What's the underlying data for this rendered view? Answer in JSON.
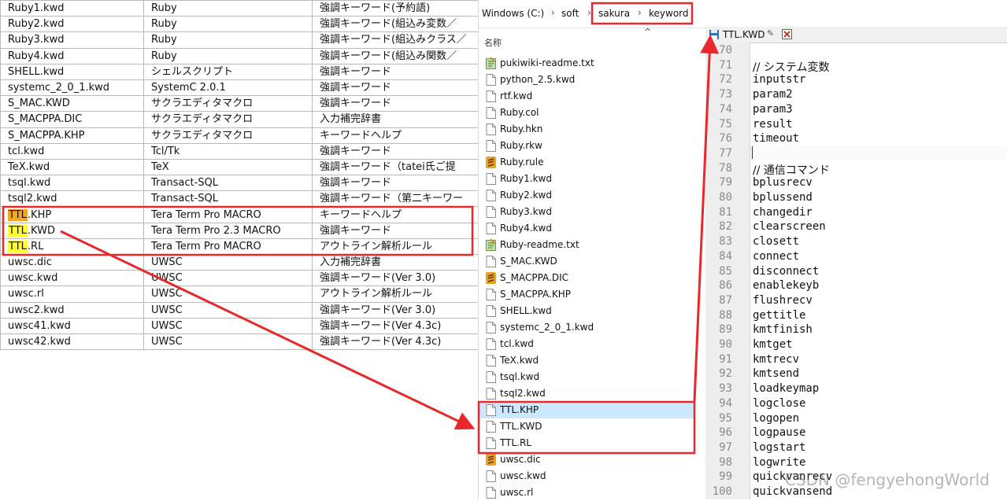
{
  "table": {
    "rows": [
      {
        "file": "Ruby1.kwd",
        "lang": "Ruby",
        "desc": "強調キーワード(予約語)"
      },
      {
        "file": "Ruby2.kwd",
        "lang": "Ruby",
        "desc": "強調キーワード(組込み変数／"
      },
      {
        "file": "Ruby3.kwd",
        "lang": "Ruby",
        "desc": "強調キーワード(組込みクラス／"
      },
      {
        "file": "Ruby4.kwd",
        "lang": "Ruby",
        "desc": "強調キーワード(組込み関数／"
      },
      {
        "file": "SHELL.kwd",
        "lang": "シェルスクリプト",
        "desc": "強調キーワード"
      },
      {
        "file": "systemc_2_0_1.kwd",
        "lang": "SystemC 2.0.1",
        "desc": "強調キーワード"
      },
      {
        "file": "S_MAC.KWD",
        "lang": "サクラエディタマクロ",
        "desc": "強調キーワード"
      },
      {
        "file": "S_MACPPA.DIC",
        "lang": "サクラエディタマクロ",
        "desc": "入力補完辞書"
      },
      {
        "file": "S_MACPPA.KHP",
        "lang": "サクラエディタマクロ",
        "desc": "キーワードヘルプ"
      },
      {
        "file": "tcl.kwd",
        "lang": "Tcl/Tk",
        "desc": "強調キーワード"
      },
      {
        "file": "TeX.kwd",
        "lang": "TeX",
        "desc": "強調キーワード（tatei氏ご提"
      },
      {
        "file": "tsql.kwd",
        "lang": "Transact-SQL",
        "desc": "強調キーワード"
      },
      {
        "file": "tsql2.kwd",
        "lang": "Transact-SQL",
        "desc": "強調キーワード（第二キーワー"
      },
      {
        "file_hl": "TTL",
        "file_rest": ".KHP",
        "hl_color": "#f5a623",
        "lang": "Tera Term Pro MACRO",
        "desc": "キーワードヘルプ"
      },
      {
        "file_hl": "TTL",
        "file_rest": ".KWD",
        "hl_color": "#ffff33",
        "lang": "Tera Term Pro 2.3 MACRO",
        "desc": "強調キーワード"
      },
      {
        "file_hl": "TTL",
        "file_rest": ".RL",
        "hl_color": "#ffff33",
        "lang": "Tera Term Pro MACRO",
        "desc": "アウトライン解析ルール"
      },
      {
        "file": "uwsc.dic",
        "lang": "UWSC",
        "desc": "入力補完辞書"
      },
      {
        "file": "uwsc.kwd",
        "lang": "UWSC",
        "desc": "強調キーワード(Ver 3.0)"
      },
      {
        "file": "uwsc.rl",
        "lang": "UWSC",
        "desc": "アウトライン解析ルール"
      },
      {
        "file": "uwsc2.kwd",
        "lang": "UWSC",
        "desc": "強調キーワード(Ver 3.0)"
      },
      {
        "file": "uwsc41.kwd",
        "lang": "UWSC",
        "desc": "強調キーワード(Ver 4.3c)"
      },
      {
        "file": "uwsc42.kwd",
        "lang": "UWSC",
        "desc": "強調キーワード(Ver 4.3c)"
      }
    ]
  },
  "explorer": {
    "breadcrumb": [
      "Windows (C:)",
      "soft",
      "sakura",
      "keyword"
    ],
    "breadcrumb_sep": "›",
    "sort_arrow": "^",
    "column_name": "名称",
    "files": [
      {
        "name": "pukiwiki-readme.txt",
        "icon": "notepad-icon"
      },
      {
        "name": "python_2.5.kwd",
        "icon": "file-icon"
      },
      {
        "name": "rtf.kwd",
        "icon": "file-icon"
      },
      {
        "name": "Ruby.col",
        "icon": "file-icon"
      },
      {
        "name": "Ruby.hkn",
        "icon": "file-icon"
      },
      {
        "name": "Ruby.rkw",
        "icon": "file-icon"
      },
      {
        "name": "Ruby.rule",
        "icon": "sublime-icon"
      },
      {
        "name": "Ruby1.kwd",
        "icon": "file-icon"
      },
      {
        "name": "Ruby2.kwd",
        "icon": "file-icon"
      },
      {
        "name": "Ruby3.kwd",
        "icon": "file-icon"
      },
      {
        "name": "Ruby4.kwd",
        "icon": "file-icon"
      },
      {
        "name": "Ruby-readme.txt",
        "icon": "notepad-icon"
      },
      {
        "name": "S_MAC.KWD",
        "icon": "file-icon"
      },
      {
        "name": "S_MACPPA.DIC",
        "icon": "sublime-icon"
      },
      {
        "name": "S_MACPPA.KHP",
        "icon": "file-icon"
      },
      {
        "name": "SHELL.kwd",
        "icon": "file-icon"
      },
      {
        "name": "systemc_2_0_1.kwd",
        "icon": "file-icon"
      },
      {
        "name": "tcl.kwd",
        "icon": "file-icon"
      },
      {
        "name": "TeX.kwd",
        "icon": "file-icon"
      },
      {
        "name": "tsql.kwd",
        "icon": "file-icon"
      },
      {
        "name": "tsql2.kwd",
        "icon": "file-icon"
      },
      {
        "name": "TTL.KHP",
        "icon": "file-icon",
        "selected": true
      },
      {
        "name": "TTL.KWD",
        "icon": "file-icon"
      },
      {
        "name": "TTL.RL",
        "icon": "file-icon"
      },
      {
        "name": "uwsc.dic",
        "icon": "sublime-icon"
      },
      {
        "name": "uwsc.kwd",
        "icon": "file-icon"
      },
      {
        "name": "uwsc.rl",
        "icon": "file-icon"
      }
    ]
  },
  "editor": {
    "tab_title": "TTL.KWD",
    "tab_icons": [
      "save-icon",
      "pin-icon",
      "close-icon"
    ],
    "lines": [
      {
        "n": "70",
        "text": ""
      },
      {
        "n": "71",
        "text": "// システム変数"
      },
      {
        "n": "72",
        "text": "inputstr"
      },
      {
        "n": "73",
        "text": "param2"
      },
      {
        "n": "74",
        "text": "param3"
      },
      {
        "n": "75",
        "text": "result"
      },
      {
        "n": "76",
        "text": "timeout"
      },
      {
        "n": "77",
        "text": ""
      },
      {
        "n": "78",
        "text": "// 通信コマンド"
      },
      {
        "n": "79",
        "text": "bplusrecv"
      },
      {
        "n": "80",
        "text": "bplussend"
      },
      {
        "n": "81",
        "text": "changedir"
      },
      {
        "n": "82",
        "text": "clearscreen"
      },
      {
        "n": "83",
        "text": "closett"
      },
      {
        "n": "84",
        "text": "connect"
      },
      {
        "n": "85",
        "text": "disconnect"
      },
      {
        "n": "86",
        "text": "enablekeyb"
      },
      {
        "n": "87",
        "text": "flushrecv"
      },
      {
        "n": "88",
        "text": "gettitle"
      },
      {
        "n": "89",
        "text": "kmtfinish"
      },
      {
        "n": "90",
        "text": "kmtget"
      },
      {
        "n": "91",
        "text": "kmtrecv"
      },
      {
        "n": "92",
        "text": "kmtsend"
      },
      {
        "n": "93",
        "text": "loadkeymap"
      },
      {
        "n": "94",
        "text": "logclose"
      },
      {
        "n": "95",
        "text": "logopen"
      },
      {
        "n": "96",
        "text": "logpause"
      },
      {
        "n": "97",
        "text": "logstart"
      },
      {
        "n": "98",
        "text": "logwrite"
      },
      {
        "n": "99",
        "text": "quickvanrecv"
      },
      {
        "n": "100",
        "text": "quickvansend"
      }
    ]
  },
  "watermark": "CSDN @fengyehongWorld",
  "colors": {
    "annotation_red": "#e8282b",
    "selection": "#cce8ff",
    "gutter": "#eeeeee",
    "highlight_orange": "#f5a623",
    "highlight_yellow": "#ffff33"
  }
}
